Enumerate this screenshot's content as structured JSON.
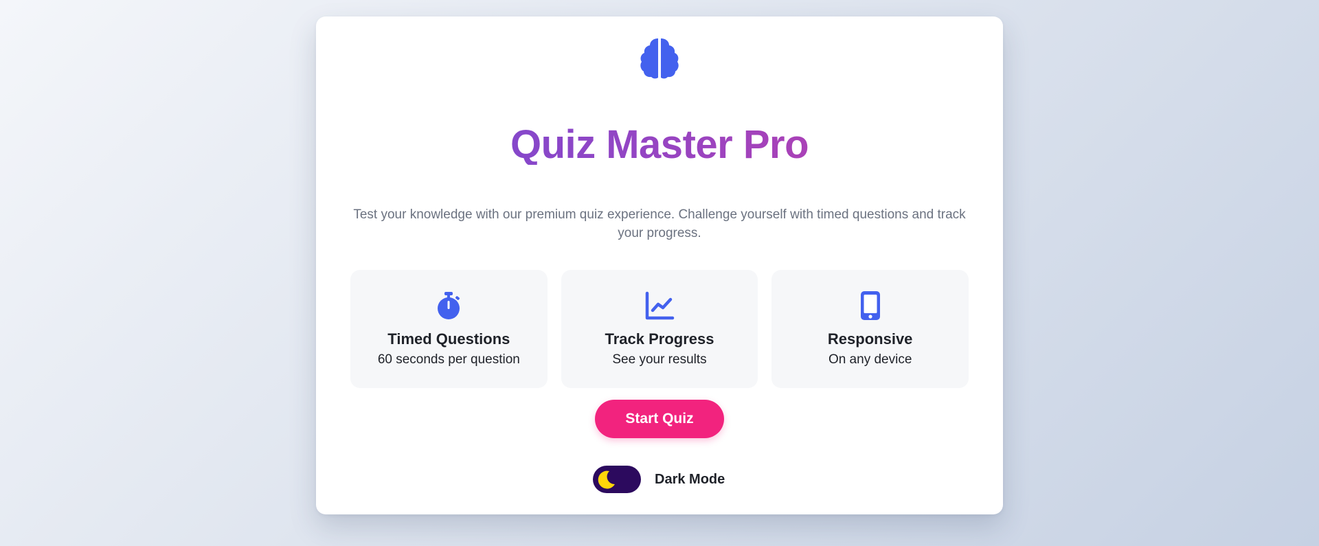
{
  "app": {
    "logo_icon": "brain-icon",
    "title": "Quiz Master Pro",
    "subtitle": "Test your knowledge with our premium quiz experience. Challenge yourself with timed questions and track your progress."
  },
  "features": [
    {
      "icon": "stopwatch-icon",
      "title": "Timed Questions",
      "description": "60 seconds per question"
    },
    {
      "icon": "chart-line-icon",
      "title": "Track Progress",
      "description": "See your results"
    },
    {
      "icon": "mobile-icon",
      "title": "Responsive",
      "description": "On any device"
    }
  ],
  "actions": {
    "start_label": "Start Quiz"
  },
  "theme_toggle": {
    "label": "Dark Mode",
    "icon": "moon-icon",
    "enabled": false
  },
  "colors": {
    "accent_blue": "#4361ee",
    "title_gradient_start": "#6f4bd6",
    "title_gradient_end": "#c53ca8",
    "button_pink": "#f2237e",
    "toggle_bg": "#2c0a5e",
    "moon_yellow": "#ffd60a"
  }
}
